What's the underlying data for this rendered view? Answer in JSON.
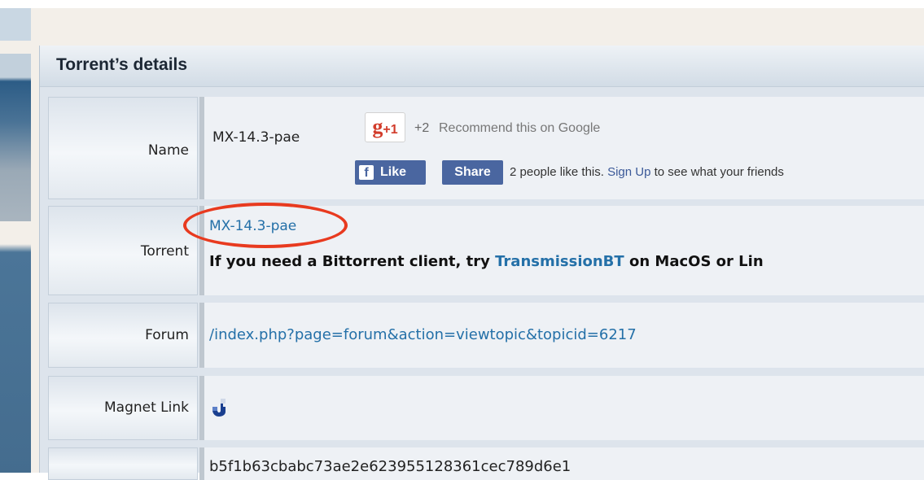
{
  "panel": {
    "title": "Torrent’s details"
  },
  "rows": {
    "name": {
      "label": "Name",
      "value": "MX-14.3-pae",
      "gplus": {
        "glyph": "g",
        "plus": "+1",
        "count": "+2",
        "recommend": "Recommend this on Google"
      },
      "facebook": {
        "like_label": "Like",
        "share_label": "Share",
        "text_before": "2 people like this.",
        "signup": "Sign Up",
        "text_after": "to see what your friends"
      }
    },
    "torrent": {
      "label": "Torrent",
      "link": "MX-14.3-pae",
      "client_prefix": "If you need a Bittorrent client, try",
      "client_link": "TransmissionBT",
      "client_suffix": "on MacOS or Lin"
    },
    "forum": {
      "label": "Forum",
      "link": "/index.php?page=forum&action=viewtopic&topicid=6217"
    },
    "magnet": {
      "label": "Magnet Link",
      "icon": "magnet-icon"
    },
    "hash": {
      "label": "",
      "value": "b5f1b63cbabc73ae2e623955128361cec789d6e1"
    }
  },
  "colors": {
    "link": "#2470a8",
    "annotation": "#e83a1f",
    "facebook": "#4a66a0",
    "gplus": "#d23c2b"
  }
}
